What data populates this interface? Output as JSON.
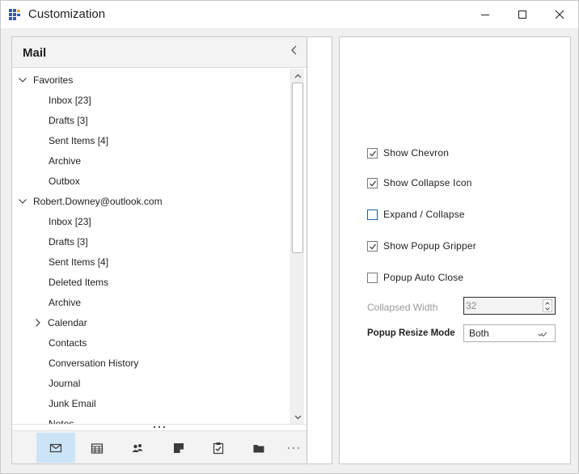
{
  "window": {
    "title": "Customization",
    "icons": {
      "app": "app-grid-icon",
      "minimize": "minimize-icon",
      "maximize": "maximize-icon",
      "close": "close-icon"
    }
  },
  "nav": {
    "title": "Mail",
    "tree": [
      {
        "label": "Favorites",
        "level": 0,
        "expander": "expanded"
      },
      {
        "label": "Inbox [23]",
        "level": 1
      },
      {
        "label": "Drafts [3]",
        "level": 1
      },
      {
        "label": "Sent Items [4]",
        "level": 1
      },
      {
        "label": "Archive",
        "level": 1
      },
      {
        "label": "Outbox",
        "level": 1
      },
      {
        "label": "Robert.Downey@outlook.com",
        "level": 0,
        "expander": "expanded"
      },
      {
        "label": "Inbox [23]",
        "level": 1
      },
      {
        "label": "Drafts [3]",
        "level": 1
      },
      {
        "label": "Sent Items [4]",
        "level": 1
      },
      {
        "label": "Deleted Items",
        "level": 1
      },
      {
        "label": "Archive",
        "level": 1
      },
      {
        "label": "Calendar",
        "level": 1,
        "expander": "collapsed"
      },
      {
        "label": "Contacts",
        "level": 1
      },
      {
        "label": "Conversation History",
        "level": 1
      },
      {
        "label": "Journal",
        "level": 1
      },
      {
        "label": "Junk Email",
        "level": 1
      },
      {
        "label": "Notes",
        "level": 1
      }
    ],
    "footer_buttons": [
      {
        "name": "mail",
        "icon": "mail-icon",
        "active": true
      },
      {
        "name": "calendar",
        "icon": "calendar-icon",
        "active": false
      },
      {
        "name": "people",
        "icon": "people-icon",
        "active": false
      },
      {
        "name": "notes",
        "icon": "note-icon",
        "active": false
      },
      {
        "name": "tasks",
        "icon": "tasks-icon",
        "active": false
      },
      {
        "name": "folders",
        "icon": "folder-icon",
        "active": false
      }
    ],
    "accent": "#cce4f7"
  },
  "settings": {
    "options": [
      {
        "label": "Show Chevron",
        "checked": true
      },
      {
        "label": "Show Collapse Icon",
        "checked": true
      },
      {
        "label": "Expand / Collapse",
        "checked": false,
        "focused": true
      },
      {
        "label": "Show Popup Gripper",
        "checked": true
      },
      {
        "label": "Popup Auto Close",
        "checked": false
      }
    ],
    "collapsed_width": {
      "label": "Collapsed Width",
      "value": "32",
      "disabled": true
    },
    "popup_resize_mode": {
      "label": "Popup Resize Mode",
      "value": "Both"
    }
  }
}
